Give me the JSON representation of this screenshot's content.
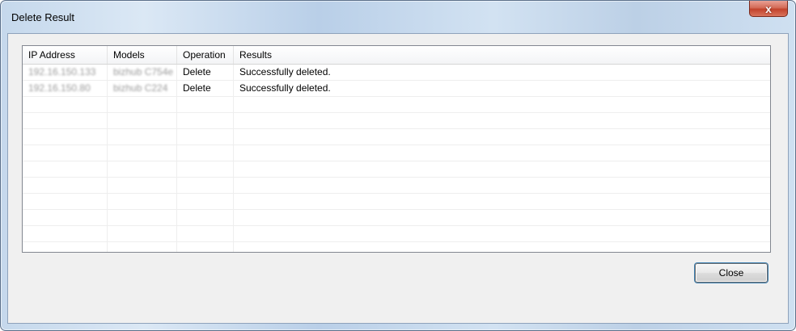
{
  "window": {
    "title": "Delete Result",
    "close_glyph": "x"
  },
  "table": {
    "columns": [
      "IP Address",
      "Models",
      "Operation",
      "Results"
    ],
    "rows": [
      {
        "ip": "192.16.150.133",
        "model": "bizhub C754e",
        "operation": "Delete",
        "result": "Successfully deleted."
      },
      {
        "ip": "192.16.150.80",
        "model": "bizhub C224",
        "operation": "Delete",
        "result": "Successfully deleted."
      }
    ],
    "empty_rows": 9
  },
  "buttons": {
    "close_label": "Close"
  }
}
